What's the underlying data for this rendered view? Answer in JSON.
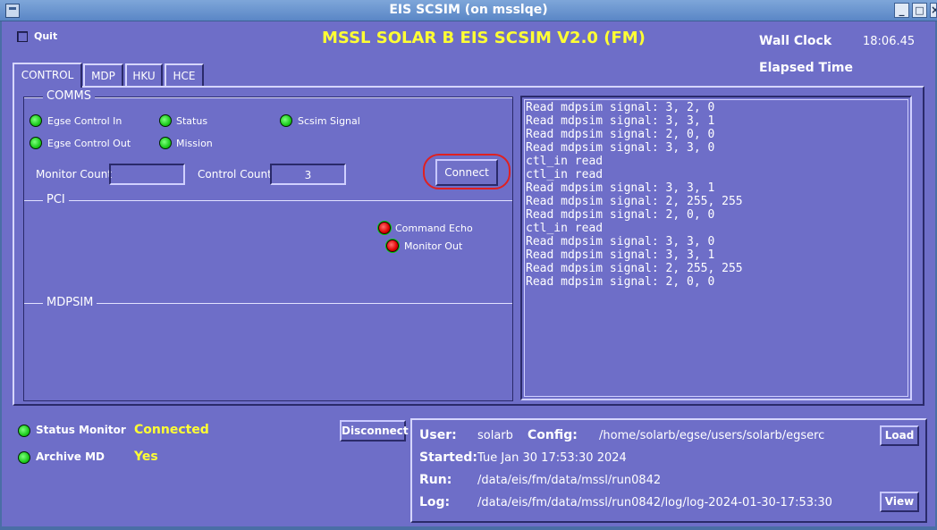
{
  "window": {
    "title": "EIS SCSIM (on msslqe)",
    "buttons": [
      "_",
      "□",
      "×"
    ]
  },
  "header": {
    "quit_label": "Quit",
    "app_title": "MSSL SOLAR B EIS SCSIM V2.0 (FM)",
    "wall_clock_label": "Wall Clock",
    "wall_clock_value": "18:06.45",
    "elapsed_label": "Elapsed Time"
  },
  "tabs": [
    "CONTROL",
    "MDP",
    "HKU",
    "HCE"
  ],
  "comms": {
    "legend": "COMMS",
    "leds": [
      {
        "label": "Egse Control In",
        "color": "green"
      },
      {
        "label": "Status",
        "color": "green"
      },
      {
        "label": "Scsim Signal",
        "color": "green"
      },
      {
        "label": "Egse Control Out",
        "color": "green"
      },
      {
        "label": "Mission",
        "color": "green"
      }
    ],
    "monitor_count_label": "Monitor Count",
    "monitor_count_value": "",
    "control_count_label": "Control Count",
    "control_count_value": "3",
    "connect_label": "Connect"
  },
  "pci": {
    "legend": "PCI",
    "leds": [
      {
        "label": "Command Echo",
        "color": "red"
      },
      {
        "label": "Monitor Out",
        "color": "red"
      }
    ]
  },
  "mdpsim": {
    "legend": "MDPSIM"
  },
  "log_lines": [
    "Read mdpsim signal: 3, 2, 0",
    "Read mdpsim signal: 3, 3, 1",
    "Read mdpsim signal: 2, 0, 0",
    "Read mdpsim signal: 3, 3, 0",
    "ctl_in read",
    "ctl_in read",
    "Read mdpsim signal: 3, 3, 1",
    "Read mdpsim signal: 2, 255, 255",
    "Read mdpsim signal: 2, 0, 0",
    "ctl_in read",
    "Read mdpsim signal: 3, 3, 0",
    "Read mdpsim signal: 3, 3, 1",
    "Read mdpsim signal: 2, 255, 255",
    "Read mdpsim signal: 2, 0, 0"
  ],
  "status": {
    "status_monitor_label": "Status Monitor",
    "status_monitor_value": "Connected",
    "archive_label": "Archive MD",
    "archive_value": "Yes",
    "disconnect_label": "Disconnect"
  },
  "info": {
    "user_label": "User:",
    "user_value": "solarb",
    "config_label": "Config:",
    "config_value": "/home/solarb/egse/users/solarb/egserc",
    "load_label": "Load",
    "started_label": "Started:",
    "started_value": "Tue Jan 30 17:53:30 2024",
    "run_label": "Run:",
    "run_value": "/data/eis/fm/data/mssl/run0842",
    "log_label": "Log:",
    "log_value": "/data/eis/fm/data/mssl/run0842/log/log-2024-01-30-17:53:30",
    "view_label": "View"
  },
  "colors": {
    "background": "#6e6ec8",
    "accent_yellow": "#ffff33",
    "led_green": "#1ccc1c",
    "led_red": "#e00000",
    "highlight_ring": "#e02020"
  }
}
